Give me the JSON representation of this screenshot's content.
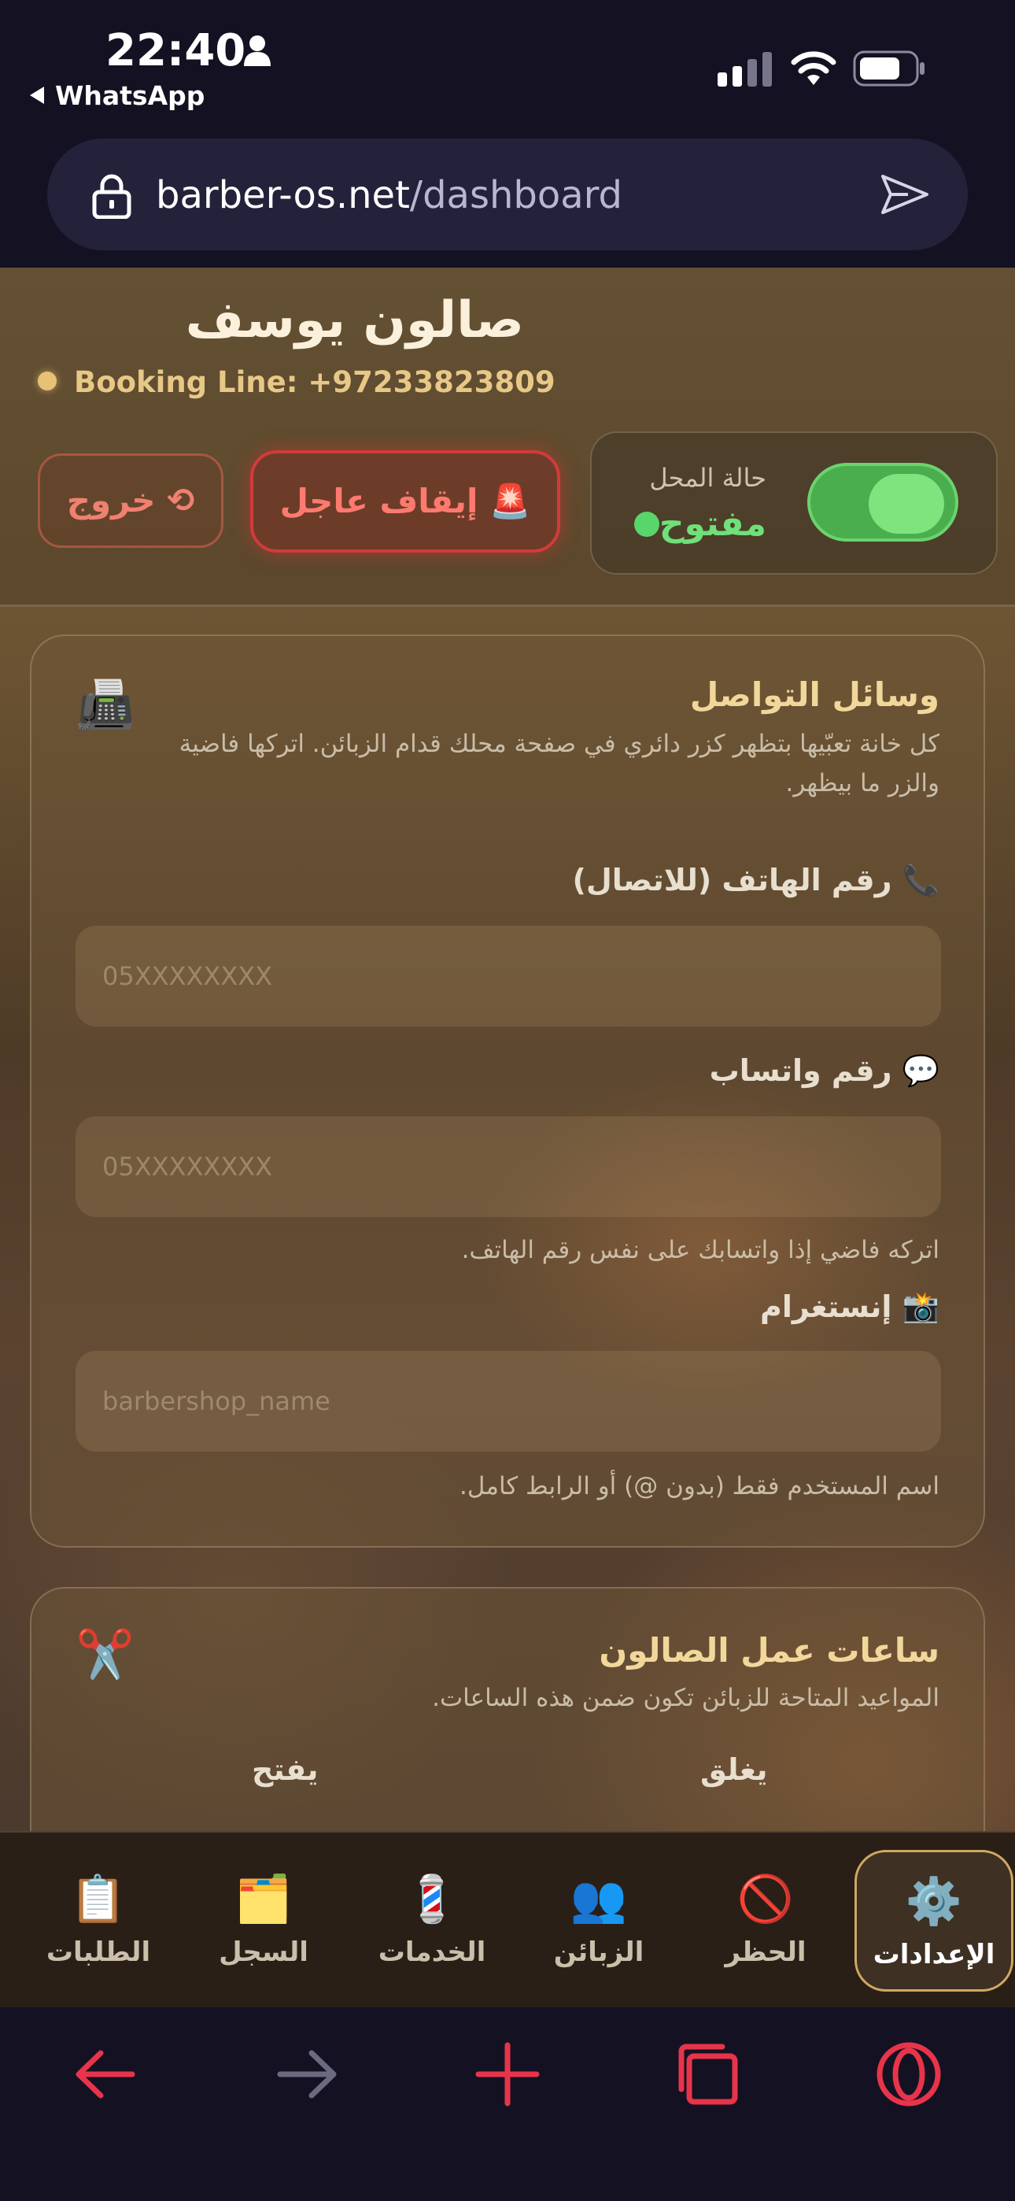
{
  "status_bar": {
    "time": "22:40",
    "back_app": "WhatsApp"
  },
  "browser": {
    "url_domain": "barber-os.net",
    "url_path": "/dashboard"
  },
  "header": {
    "salon_name": "صالون يوسف",
    "booking_line": "Booking Line: +97233823809",
    "status_label": "حالة المحل",
    "status_value": "مفتوح",
    "store_open": true,
    "emergency_button": "🚨 إيقاف عاجل",
    "exit_button": "⟲ خروج"
  },
  "social_card": {
    "title": "وسائل التواصل",
    "description": "كل خانة تعبّيها بتظهر كزر دائري في صفحة محلك قدام الزبائن. اتركها فاضية والزر ما بيظهر.",
    "icon": "📠",
    "fields": [
      {
        "label": "📞 رقم الهاتف (للاتصال)",
        "placeholder": "05XXXXXXXX",
        "value": ""
      },
      {
        "label": "💬 رقم واتساب",
        "placeholder": "05XXXXXXXX",
        "value": "",
        "hint": "اتركه فاضي إذا واتسابك على نفس رقم الهاتف."
      },
      {
        "label": "📸 إنستغرام",
        "placeholder": "barbershop_name",
        "value": "",
        "hint": "اسم المستخدم فقط (بدون @) أو الرابط كامل."
      }
    ]
  },
  "hours_card": {
    "title": "ساعات عمل الصالون",
    "description": "المواعيد المتاحة للزبائن تكون ضمن هذه الساعات.",
    "icon": "✂️",
    "close_label": "يغلق",
    "open_label": "يفتح"
  },
  "bottom_nav": [
    {
      "label": "الطلبات",
      "icon": "📋"
    },
    {
      "label": "السجل",
      "icon": "🗂️"
    },
    {
      "label": "الخدمات",
      "icon": "💈"
    },
    {
      "label": "الزبائن",
      "icon": "👥"
    },
    {
      "label": "الحظر",
      "icon": "🚫"
    },
    {
      "label": "الإعدادات",
      "icon": "⚙️"
    }
  ],
  "active_tab": "الإعدادات",
  "colors": {
    "accent_gold": "#e8c887",
    "open_green": "#6fe07a",
    "danger_red": "#d23b3b",
    "browser_red": "#e8344a"
  }
}
